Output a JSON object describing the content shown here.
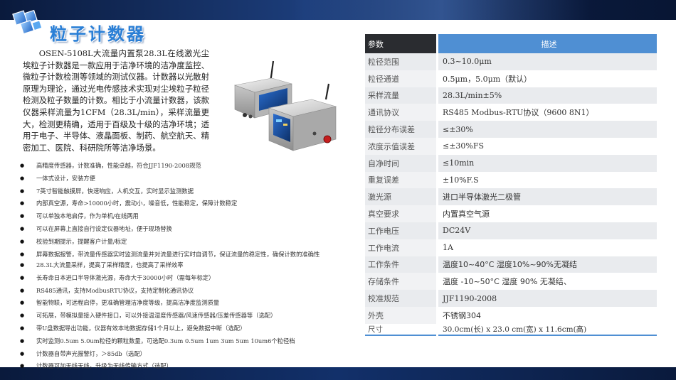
{
  "title": "粒子计数器",
  "intro": "OSEN-5108L大流量内置泵28.3L在线激光尘埃粒子计数器是一款应用于洁净环境的洁净度监控、微粒子计数检测等领域的测试仪器。计数器以光散射原理为理论，通过光电传感技术实现对尘埃粒子粒径检测及粒子数量的计数。相比于小流量计数器，该款仪器采样流量为1CFM（28.3L/min），采样流量更大，检测更精确，适用于百级及十级的洁净环境；适用于电子、半导体、液晶面板、制药、航空航天、精密加工、医院、科研院所等洁净场景。",
  "features": [
    "高精度传感器，计数准确，性能卓越，符合JJF1190-2008规范",
    "一体式设计，安装方便",
    "7英寸智能触摸屏，快速响应，人机交互，实时显示监测数据",
    "内部真空源，寿命>10000小时，震动小，噪音低，性能稳定，保障计数稳定",
    "可以单独本地启停，作为单机/在线两用",
    "可以在屏幕上直接自行设定仪器地址，便于现场替换",
    "校验到期提示，提醒客户计量/标定",
    "屏幕数据报警，带流量传感器实时监测流量并对流量进行实时自调节，保证流量的稳定性，确保计数的准确性",
    "28.3L大流量采样，提高了采样精度，也提高了采样效率",
    "长寿命日本进口半导体激光源，寿命大于30000小时（需每年标定）",
    "RS485通讯，支持ModbusRTU协议，支持定制化通讯协议",
    "智能物联，可远程启停，更准确管理洁净度等级，提高洁净度监测质量",
    "可拓展，带模拟量接入硬件接口，可以外接温湿度传感器/风速传感器/压差传感器等（选配）",
    "带U盘数据导出功能，仪器有效本地数据存储1个月以上，避免数据中断（选配）",
    "实时监测0.5um 5.0um粒径的颗粒数量，可选配0.3um 0.5um 1um 3um 5um 10um6个粒径档",
    "计数器自带声光报警灯，＞85db（选配）",
    "计数器可加无线天线，升级为无线传输方式（选配）"
  ],
  "table": {
    "header_param": "参数",
    "header_desc": "描述",
    "rows": [
      {
        "param": "粒径范围",
        "value": "0.3~10.0μm"
      },
      {
        "param": "粒径通道",
        "value": "0.5μm，5.0μm（默认）"
      },
      {
        "param": "采样流量",
        "value": "28.3L/min±5%"
      },
      {
        "param": "通讯协议",
        "value": "RS485 Modbus-RTU协议（9600 8N1）"
      },
      {
        "param": "粒径分布误差",
        "value": "≤±30%"
      },
      {
        "param": "浓度示值误差",
        "value": "≤±30%FS"
      },
      {
        "param": "自净时间",
        "value": "≤10min"
      },
      {
        "param": "重复误差",
        "value": "±10%F.S"
      },
      {
        "param": "激光源",
        "value": "进口半导体激光二极管"
      },
      {
        "param": "真空要求",
        "value": "内置真空气源"
      },
      {
        "param": "工作电压",
        "value": "DC24V"
      },
      {
        "param": "工作电流",
        "value": "1A"
      },
      {
        "param": "工作条件",
        "value": "温度10~40°C 湿度10%~90%无凝结"
      },
      {
        "param": "存储条件",
        "value": "温度 -10~50°C 湿度 90% 无凝结、"
      },
      {
        "param": "校准规范",
        "value": "JJF1190-2008"
      },
      {
        "param": "外壳",
        "value": "不锈钢304"
      },
      {
        "param": "尺寸",
        "value": "30.0cm(长) x 23.0 cm(宽) x 11.6cm(高)"
      }
    ]
  },
  "colors": {
    "title_blue": "#2a7fd6",
    "header_dark": "#2a2c30",
    "header_blue": "#4f8fd3",
    "band_navy": "#0a1a3c"
  },
  "icons": {
    "logo": "stacked-cubes-logo",
    "bullet": "filled-circle-bullet",
    "device": "particle-counter-device-illustration"
  }
}
